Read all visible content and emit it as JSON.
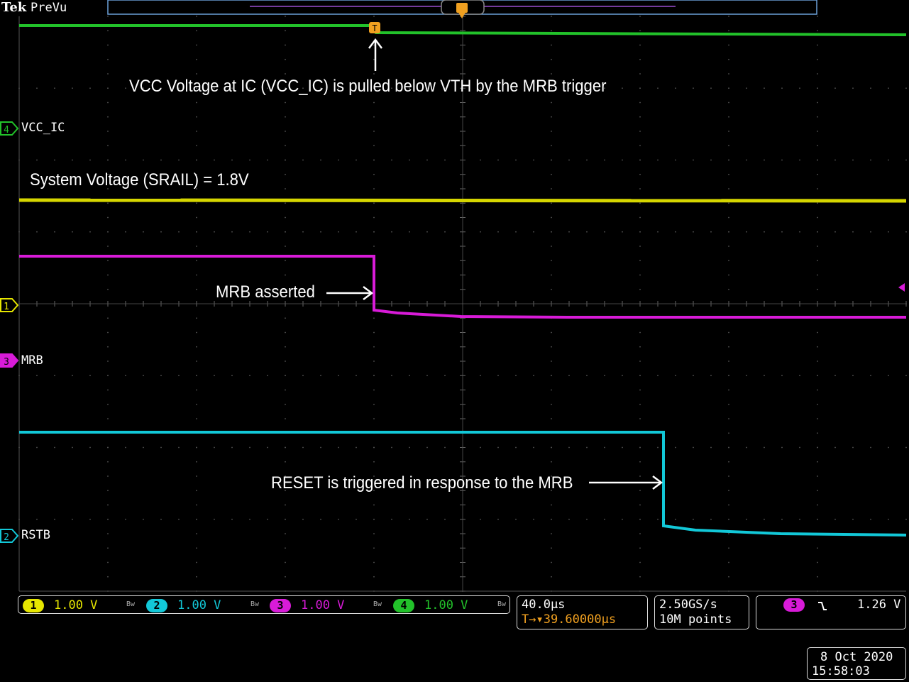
{
  "header": {
    "brand": "Tek",
    "mode": "PreVu",
    "trigger_marker": "T"
  },
  "channel_labels": [
    {
      "num": "4",
      "name": "VCC_IC",
      "color": "#22c22a"
    },
    {
      "num": "1",
      "name": "",
      "color": "#e6e600"
    },
    {
      "num": "3",
      "name": "MRB",
      "color": "#d81bd8"
    },
    {
      "num": "2",
      "name": "RSTB",
      "color": "#12c8d8"
    }
  ],
  "annotations": {
    "vcc": "VCC Voltage at IC (VCC_IC) is pulled below VTH by the MRB trigger",
    "srail": "System Voltage (SRAIL) = 1.8V",
    "mrb": "MRB asserted",
    "reset": "RESET is triggered in response to the MRB"
  },
  "statusbar": {
    "channels": [
      {
        "num": "1",
        "scale": "1.00 V",
        "color": "#e6e600"
      },
      {
        "num": "2",
        "scale": "1.00 V",
        "color": "#12c8d8"
      },
      {
        "num": "3",
        "scale": "1.00 V",
        "color": "#d81bd8"
      },
      {
        "num": "4",
        "scale": "1.00 V",
        "color": "#22c22a"
      }
    ],
    "bw_mark": "Bw",
    "timebase": "40.0µs",
    "trigger_position": "T→▾39.60000µs",
    "sample_rate": "2.50GS/s",
    "record_length": "10M points",
    "trigger_source": "3",
    "trigger_slope": "falling-edge-icon",
    "trigger_level": "1.26 V"
  },
  "datetime": {
    "date": "8 Oct  2020",
    "time": "15:58:03"
  }
}
